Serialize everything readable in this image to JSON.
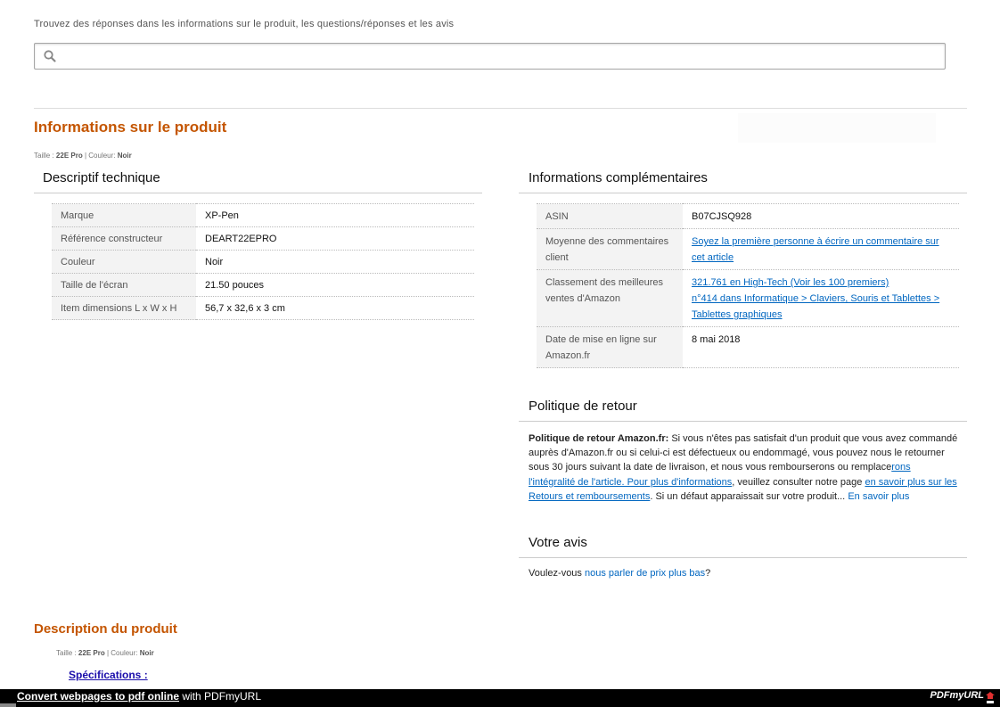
{
  "search": {
    "hint": "Trouvez des réponses dans les informations sur le produit, les questions/réponses et les avis",
    "placeholder": ""
  },
  "product_info": {
    "title": "Informations sur le produit",
    "size_label": "Taille :",
    "size_value": "22E Pro",
    "separator": "|",
    "color_label": "Couleur:",
    "color_value": "Noir"
  },
  "tech": {
    "heading": "Descriptif technique",
    "rows": [
      {
        "key": "Marque",
        "value": "XP-Pen"
      },
      {
        "key": "Référence constructeur",
        "value": "DEART22EPRO"
      },
      {
        "key": "Couleur",
        "value": "Noir"
      },
      {
        "key": "Taille de l'écran",
        "value": "21.50 pouces"
      },
      {
        "key": "Item dimensions L x W x H",
        "value": "56,7 x 32,6 x 3 cm"
      }
    ]
  },
  "info": {
    "heading": "Informations complémentaires",
    "asin_key": "ASIN",
    "asin_value": "B07CJSQ928",
    "rating_key": "Moyenne des commentaires client",
    "rating_link": "Soyez la première personne à écrire un commentaire sur cet article",
    "rank_key": "Classement des meilleures ventes d'Amazon",
    "rank_link_1": "321.761 en High-Tech (Voir les 100 premiers)",
    "rank_link_2": "n°414 dans Informatique > Claviers, Souris et Tablettes > Tablettes graphiques",
    "date_key": "Date de mise en ligne sur Amazon.fr",
    "date_value": "8 mai 2018"
  },
  "returns": {
    "heading": "Politique de retour",
    "label": "Politique de retour Amazon.fr:",
    "text_1": " Si vous n'êtes pas satisfait d'un produit que vous avez commandé auprès d'Amazon.fr ou si celui-ci est défectueux ou endommagé, vous pouvez nous le retourner sous 30 jours suivant la date de livraison, et nous vous rembourserons ou remplace",
    "link_1": "rons l'intégralité de l'article. Pour plus d'informations",
    "text_2": ", veuillez consulter notre page ",
    "link_2": "en savoir plus sur les Retours et remboursements",
    "text_3": ". Si un défaut apparaissait sur votre produit... ",
    "link_3": "En savoir plus"
  },
  "review": {
    "heading": "Votre avis",
    "text": "Voulez-vous ",
    "link": "nous parler de prix plus bas",
    "suffix": "?"
  },
  "description": {
    "title": "Description du produit",
    "size_label": "Taille :",
    "size_value": "22E Pro",
    "separator": "|",
    "color_label": "Couleur:",
    "color_value": "Noir",
    "spec_link": "Spécifications :"
  },
  "footer": {
    "link": "Convert webpages to pdf online",
    "text": " with PDFmyURL",
    "logo": "PDFmyURL"
  },
  "colors": {
    "accent_orange": "#c45500",
    "link_blue": "#0066c0",
    "footer_bg": "#000000"
  }
}
